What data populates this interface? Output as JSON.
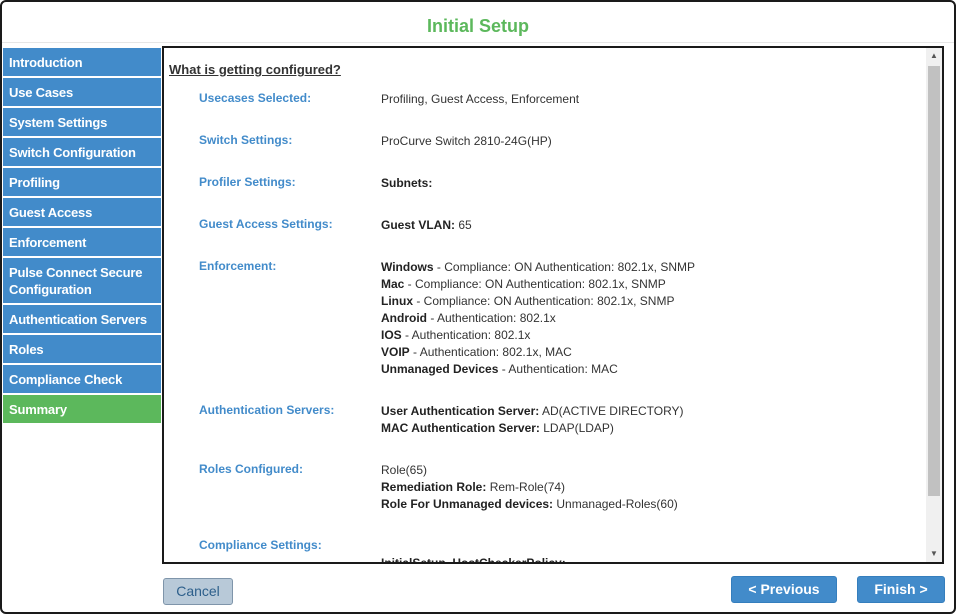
{
  "window": {
    "title": "Initial Setup"
  },
  "sidebar": {
    "items": [
      {
        "label": "Introduction",
        "active": false
      },
      {
        "label": "Use Cases",
        "active": false
      },
      {
        "label": "System Settings",
        "active": false
      },
      {
        "label": "Switch Configuration",
        "active": false
      },
      {
        "label": "Profiling",
        "active": false
      },
      {
        "label": "Guest Access",
        "active": false
      },
      {
        "label": "Enforcement",
        "active": false
      },
      {
        "label": "Pulse Connect Secure Configuration",
        "active": false
      },
      {
        "label": "Authentication Servers",
        "active": false
      },
      {
        "label": "Roles",
        "active": false
      },
      {
        "label": "Compliance Check",
        "active": false
      },
      {
        "label": "Summary",
        "active": true
      }
    ]
  },
  "summary": {
    "heading": "What is getting configured?",
    "usecases": {
      "label": "Usecases Selected:",
      "value": "Profiling, Guest Access, Enforcement"
    },
    "switch": {
      "label": "Switch Settings:",
      "value": "ProCurve Switch 2810-24G(HP)"
    },
    "profiler": {
      "label": "Profiler Settings:",
      "key": "Subnets:"
    },
    "guest": {
      "label": "Guest Access Settings:",
      "key": "Guest VLAN:",
      "value": " 65"
    },
    "enforcement": {
      "label": "Enforcement:",
      "lines": [
        {
          "key": "Windows",
          "value": " - Compliance: ON Authentication: 802.1x, SNMP"
        },
        {
          "key": "Mac",
          "value": " - Compliance: ON Authentication: 802.1x, SNMP"
        },
        {
          "key": "Linux",
          "value": " - Compliance: ON Authentication: 802.1x, SNMP"
        },
        {
          "key": "Android",
          "value": " - Authentication: 802.1x"
        },
        {
          "key": "IOS",
          "value": " - Authentication: 802.1x"
        },
        {
          "key": "VOIP",
          "value": " - Authentication: 802.1x, MAC"
        },
        {
          "key": "Unmanaged Devices",
          "value": " - Authentication: MAC"
        }
      ]
    },
    "auth_servers": {
      "label": "Authentication Servers:",
      "lines": [
        {
          "key": "User Authentication Server:",
          "value": " AD(ACTIVE DIRECTORY)"
        },
        {
          "key": "MAC Authentication Server:",
          "value": " LDAP(LDAP)"
        }
      ]
    },
    "roles": {
      "label": "Roles Configured:",
      "plain": "Role(65)",
      "lines": [
        {
          "key": "Remediation Role:",
          "value": " Rem-Role(74)"
        },
        {
          "key": "Role For Unmanaged devices:",
          "value": " Unmanaged-Roles(60)"
        }
      ]
    },
    "compliance": {
      "label": "Compliance Settings:",
      "key": "InitialSetup_HostCheckerPolicy:"
    }
  },
  "buttons": {
    "cancel": "Cancel",
    "previous": "< Previous",
    "finish": "Finish >"
  },
  "colors": {
    "accent": "#428bca",
    "active": "#5cb85c",
    "title": "#5cb85c"
  },
  "icons": {
    "scroll_up": "scroll-up-arrow-icon",
    "scroll_down": "scroll-down-arrow-icon"
  }
}
